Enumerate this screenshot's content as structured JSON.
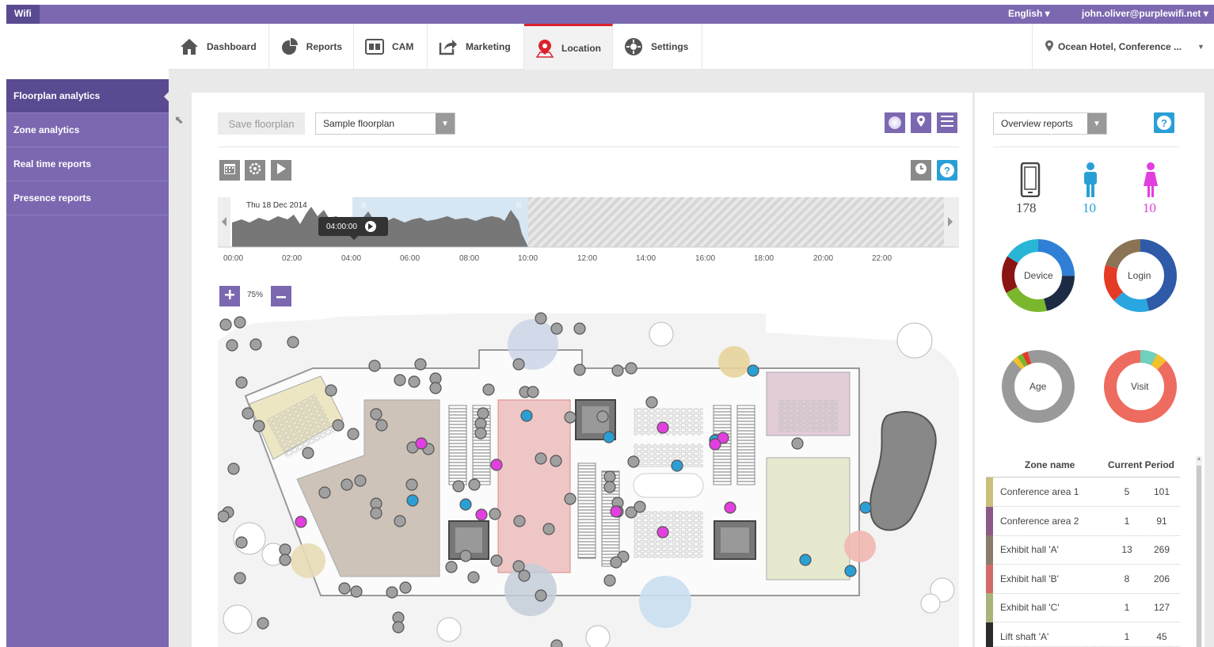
{
  "topbar": {
    "brand": "Wifi",
    "language": "English ▾",
    "user": "john.oliver@purplewifi.net ▾"
  },
  "nav": {
    "items": [
      {
        "label": "Dashboard",
        "icon": "home-icon"
      },
      {
        "label": "Reports",
        "icon": "pie-chart-icon"
      },
      {
        "label": "CAM",
        "icon": "contact-card-icon"
      },
      {
        "label": "Marketing",
        "icon": "share-arrow-icon"
      },
      {
        "label": "Location",
        "icon": "map-pin-icon",
        "active": true
      },
      {
        "label": "Settings",
        "icon": "gear-icon"
      }
    ],
    "venue": "Ocean Hotel, Conference ..."
  },
  "sidebar": {
    "items": [
      {
        "label": "Floorplan analytics",
        "active": true
      },
      {
        "label": "Zone analytics"
      },
      {
        "label": "Real time reports"
      },
      {
        "label": "Presence reports"
      }
    ]
  },
  "toolbar": {
    "save_label": "Save floorplan",
    "floorplan_select": "Sample floorplan"
  },
  "timeline": {
    "date": "Thu 18 Dec 2014",
    "current_time": "04:00:00",
    "ticks": [
      "00:00",
      "02:00",
      "04:00",
      "06:00",
      "08:00",
      "10:00",
      "12:00",
      "14:00",
      "16:00",
      "18:00",
      "20:00",
      "22:00"
    ]
  },
  "zoom": {
    "level": "75%"
  },
  "right": {
    "report_select": "Overview reports",
    "help": "?",
    "counts": {
      "devices": "178",
      "male": "10",
      "female": "10"
    },
    "donuts": {
      "device": "Device",
      "login": "Login",
      "age": "Age",
      "visit": "Visit"
    },
    "table": {
      "headers": [
        "Zone name",
        "Current Period"
      ],
      "rows": [
        {
          "zone": "Conference area 1",
          "now": "5",
          "period": "101",
          "color": "#cbbf7c"
        },
        {
          "zone": "Conference area 2",
          "now": "1",
          "period": "91",
          "color": "#8e5a85"
        },
        {
          "zone": "Exhibit hall 'A'",
          "now": "13",
          "period": "269",
          "color": "#8a7b6d"
        },
        {
          "zone": "Exhibit hall 'B'",
          "now": "8",
          "period": "206",
          "color": "#d36a6a"
        },
        {
          "zone": "Exhibit hall 'C'",
          "now": "1",
          "period": "127",
          "color": "#a9b47a"
        },
        {
          "zone": "Lift shaft 'A'",
          "now": "1",
          "period": "45",
          "color": "#2b2b2b"
        }
      ]
    }
  },
  "colors": {
    "purple": "#7b68b0",
    "purple_dark": "#5a4a91",
    "blue": "#2a9fd6",
    "pink": "#e33ee0",
    "active_red": "#d9232e"
  }
}
